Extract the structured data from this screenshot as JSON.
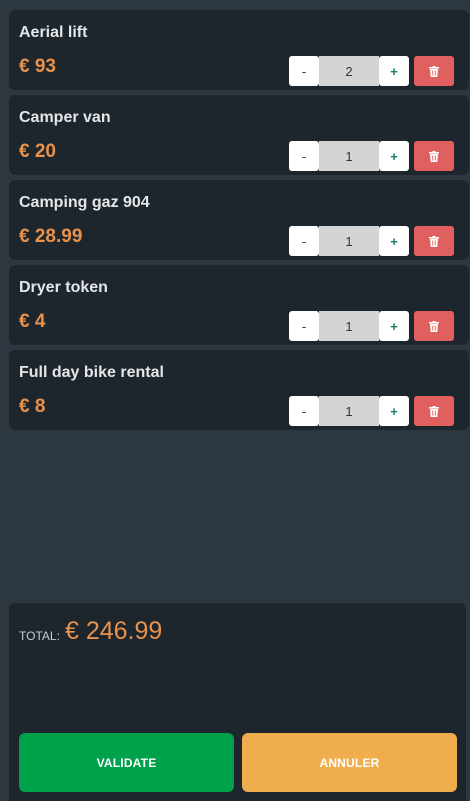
{
  "cart": {
    "items": [
      {
        "name": "Aerial lift",
        "price": "€ 93",
        "quantity": "2"
      },
      {
        "name": "Camper van",
        "price": "€ 20",
        "quantity": "1"
      },
      {
        "name": "Camping gaz 904",
        "price": "€ 28.99",
        "quantity": "1"
      },
      {
        "name": "Dryer token",
        "price": "€ 4",
        "quantity": "1"
      },
      {
        "name": "Full day bike rental",
        "price": "€ 8",
        "quantity": "1"
      }
    ],
    "decrement_label": "-",
    "increment_label": "+",
    "delete_icon": "trash-icon"
  },
  "summary": {
    "total_label": "TOTAL:",
    "total_value": "€ 246.99",
    "validate_label": "VALIDATE",
    "cancel_label": "ANNULER"
  },
  "colors": {
    "background": "#2c373f",
    "card": "#1e262d",
    "price": "#e8914a",
    "delete": "#e0605f",
    "validate": "#00a14b",
    "cancel": "#f0ad4e"
  }
}
